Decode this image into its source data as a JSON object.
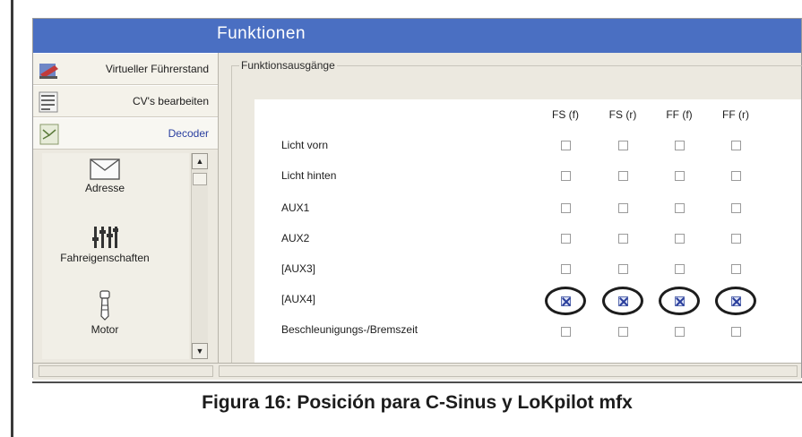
{
  "window": {
    "title": "Funktionen"
  },
  "sidebar": {
    "items": [
      {
        "label": "Virtueller Führerstand",
        "icon": "train-cab-icon",
        "active": false
      },
      {
        "label": "CV's bearbeiten",
        "icon": "binary-data-icon",
        "active": false
      },
      {
        "label": "Decoder",
        "icon": "decoder-chip-icon",
        "active": true
      }
    ],
    "tools": [
      {
        "label": "Adresse",
        "icon": "envelope-icon"
      },
      {
        "label": "Fahreigenschaften",
        "icon": "sliders-icon"
      },
      {
        "label": "Motor",
        "icon": "motor-icon"
      }
    ],
    "scroll_up": "▲",
    "scroll_down": "▼"
  },
  "functions": {
    "group_title": "Funktionsausgänge",
    "columns": [
      "FS (f)",
      "FS (r)",
      "FF (f)",
      "FF (r)"
    ],
    "rows": [
      {
        "label": "Licht vorn",
        "checked": [
          false,
          false,
          false,
          false
        ]
      },
      {
        "label": "Licht hinten",
        "checked": [
          false,
          false,
          false,
          false
        ]
      },
      {
        "label": "AUX1",
        "checked": [
          false,
          false,
          false,
          false
        ]
      },
      {
        "label": "AUX2",
        "checked": [
          false,
          false,
          false,
          false
        ]
      },
      {
        "label": "[AUX3]",
        "checked": [
          false,
          false,
          false,
          false
        ]
      },
      {
        "label": "[AUX4]",
        "checked": [
          true,
          true,
          true,
          true
        ]
      },
      {
        "label": "Beschleunigungs-/Bremszeit",
        "checked": [
          false,
          false,
          false,
          false
        ]
      }
    ]
  },
  "caption": "Figura 16: Posición para C-Sinus y LoKpilot mfx"
}
